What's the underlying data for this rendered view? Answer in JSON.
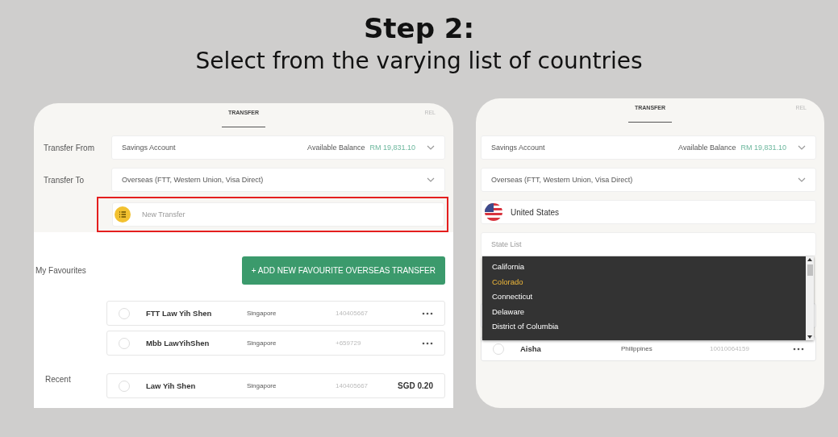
{
  "heading": {
    "title": "Step 2:",
    "subtitle": "Select from the varying list of countries"
  },
  "left_screen": {
    "tabs": [
      {
        "label": "TRANSFER",
        "selected": true
      },
      {
        "label": "REL",
        "selected": false
      }
    ],
    "transfer_from": {
      "label": "Transfer From",
      "value": "Savings Account",
      "balance_label": "Available Balance",
      "balance": "RM 19,831.10"
    },
    "transfer_to": {
      "label": "Transfer To",
      "value": "Overseas  (FTT, Western Union, Visa Direct)"
    },
    "new_transfer": {
      "placeholder": "New Transfer",
      "highlighted": true
    },
    "favourites": {
      "label": "My Favourites",
      "button": "+ ADD NEW FAVOURITE OVERSEAS TRANSFER",
      "rows": [
        {
          "name": "FTT Law Yih Shen",
          "country": "Singapore",
          "account": "140405667",
          "selected": false
        },
        {
          "name": "Mbb LawYihShen",
          "country": "Singapore",
          "account": "+659729",
          "selected": false
        }
      ]
    },
    "recent": {
      "label": "Recent",
      "rows": [
        {
          "name": "Law Yih Shen",
          "country": "Singapore",
          "account": "140405667",
          "amount": "SGD 0.20",
          "selected": false
        }
      ]
    }
  },
  "right_screen": {
    "tabs": [
      {
        "label": "TRANSFER",
        "selected": true
      },
      {
        "label": "REL",
        "selected": false
      }
    ],
    "transfer_from": {
      "value": "Savings Account",
      "balance_label": "Available Balance",
      "balance": "RM 19,831.10"
    },
    "transfer_to": {
      "value": "Overseas  (FTT, Western Union, Visa Direct)"
    },
    "country": {
      "value": "United States"
    },
    "state": {
      "placeholder": "State List"
    },
    "state_options": [
      {
        "label": "California",
        "selected": false
      },
      {
        "label": "Colorado",
        "selected": true
      },
      {
        "label": "Connecticut",
        "selected": false
      },
      {
        "label": "Delaware",
        "selected": false
      },
      {
        "label": "District of Columbia",
        "selected": false
      }
    ],
    "rows": [
      {
        "name": "Aisha",
        "country": "Philippines",
        "account": "10010064159",
        "selected": false
      }
    ]
  }
}
